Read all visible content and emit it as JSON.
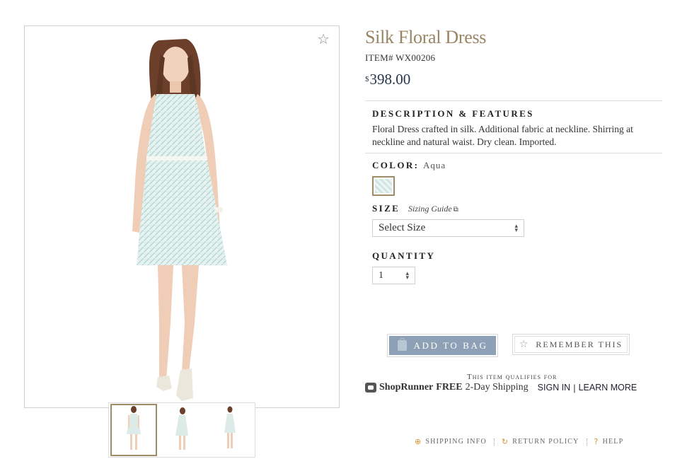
{
  "product": {
    "title": "Silk Floral Dress",
    "item_number": "ITEM# WX00206",
    "price_currency": "$",
    "price_amount": "398.00"
  },
  "description": {
    "heading": "DESCRIPTION & FEATURES",
    "body": "Floral Dress crafted in silk. Additional fabric at neckline. Shirring at neckline and natural waist. Dry clean. Imported."
  },
  "color": {
    "label": "COLOR:",
    "value": "Aqua",
    "swatch_color": "#cfe6e4"
  },
  "size": {
    "label": "SIZE",
    "sizing_guide": "Sizing Guide",
    "selected": "Select Size"
  },
  "quantity": {
    "label": "QUANTITY",
    "selected": "1"
  },
  "actions": {
    "add_to_bag": "ADD TO BAG",
    "remember": "REMEMBER THIS"
  },
  "shipping": {
    "qualifies": "This item qualifies for",
    "brand": "ShopRunner",
    "free": "FREE",
    "offer": "2-Day Shipping",
    "sign_in": "SIGN IN",
    "separator": "|",
    "learn_more": "LEARN MORE"
  },
  "footer": {
    "shipping_info": "SHIPPING INFO",
    "return_policy": "RETURN POLICY",
    "help": "HELP"
  },
  "icons": {
    "favorite": "star-outline",
    "bag": "shopping-bag",
    "external": "external-link",
    "shipping": "globe",
    "return": "return-arrow",
    "help": "question-mark"
  },
  "colors": {
    "title": "#9a8462",
    "price": "#24354a",
    "accent_border": "#a08b68",
    "button_bag": "#8ea0b5",
    "footer_icon": "#d3962f"
  }
}
